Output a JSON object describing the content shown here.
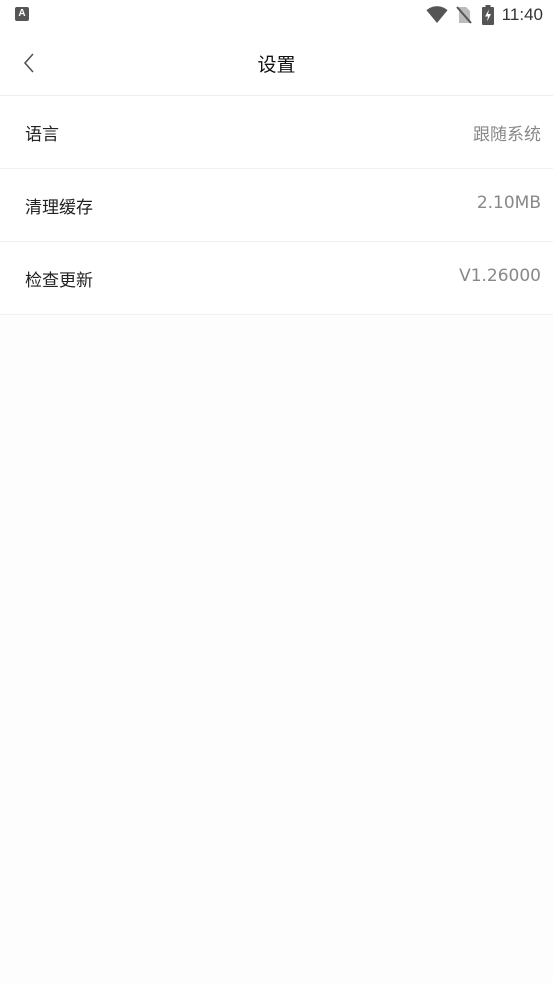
{
  "status_bar": {
    "notification_glyph": "A",
    "time": "11:40",
    "icons": [
      "wifi-icon",
      "no-sim-icon",
      "battery-charging-icon"
    ]
  },
  "header": {
    "title": "设置",
    "back_icon": "chevron-left-icon"
  },
  "settings": {
    "items": [
      {
        "label": "语言",
        "value": "跟随系统"
      },
      {
        "label": "清理缓存",
        "value": "2.10MB"
      },
      {
        "label": "检查更新",
        "value": "V1.26000"
      }
    ]
  },
  "colors": {
    "background": "#fdfdfd",
    "surface": "#ffffff",
    "divider": "#eeeeee",
    "text_primary": "#222222",
    "text_secondary": "#888888"
  }
}
